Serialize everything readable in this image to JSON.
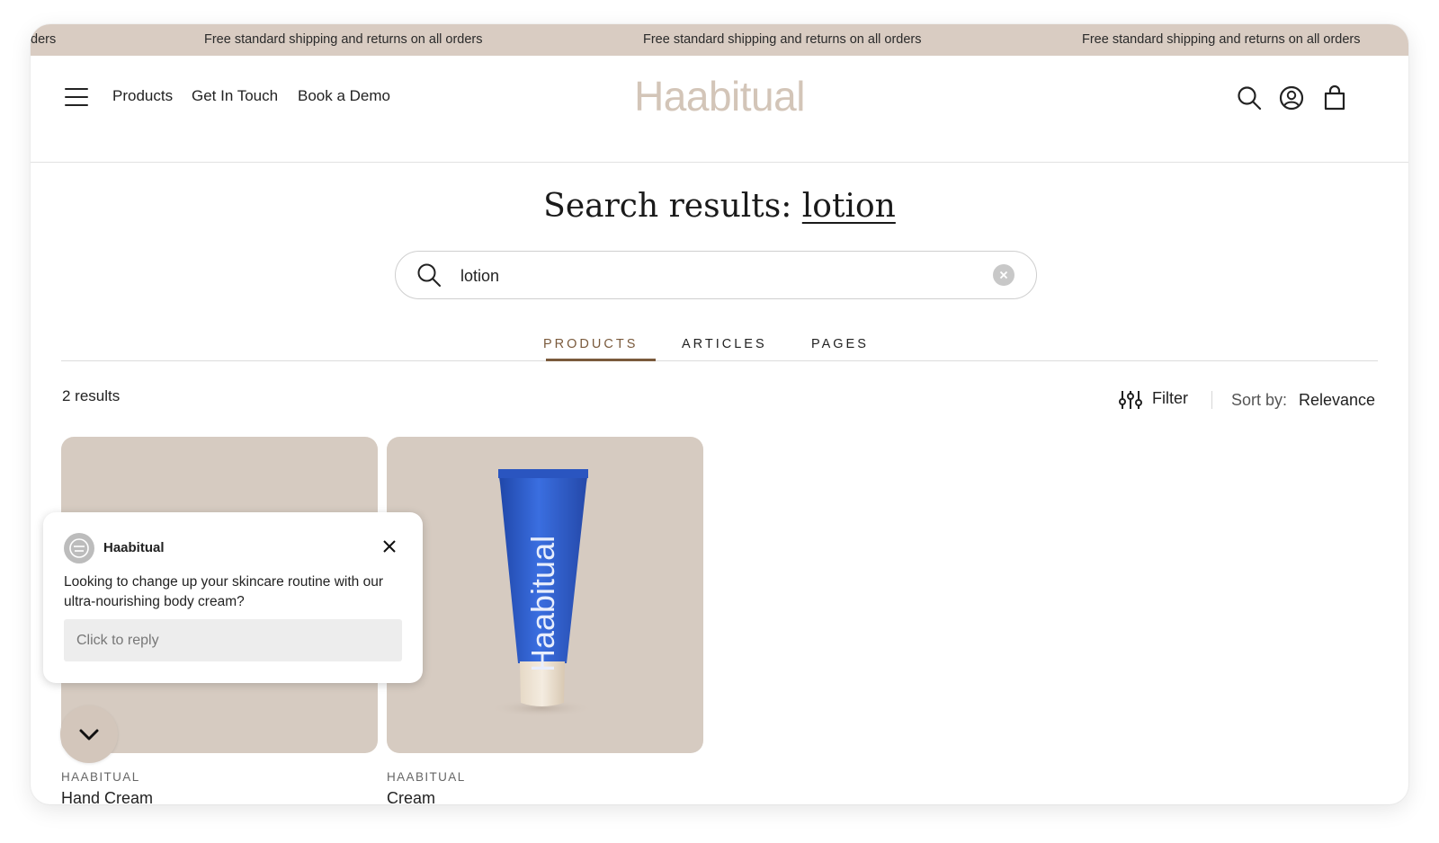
{
  "announcement": {
    "items": [
      "ders",
      "Free standard shipping and returns on all orders",
      "Free standard shipping and returns on all orders",
      "Free standard shipping and returns on all orders"
    ]
  },
  "header": {
    "nav": [
      "Products",
      "Get In Touch",
      "Book a Demo"
    ],
    "logo": "Haabitual",
    "icons": [
      "search-icon",
      "account-icon",
      "cart-icon",
      "menu-icon"
    ]
  },
  "search": {
    "title_prefix": "Search results: ",
    "query": "lotion",
    "input_value": "lotion"
  },
  "tabs": [
    {
      "label": "PRODUCTS",
      "active": true
    },
    {
      "label": "ARTICLES",
      "active": false
    },
    {
      "label": "PAGES",
      "active": false
    }
  ],
  "results": {
    "count": "2 results",
    "filter_label": "Filter",
    "sort_label": "Sort by:",
    "sort_value": "Relevance"
  },
  "products": [
    {
      "vendor": "HAABITUAL",
      "name": "Hand Cream"
    },
    {
      "vendor": "HAABITUAL",
      "name": "Cream",
      "tube_text": "Haabitual"
    }
  ],
  "chat": {
    "brand": "Haabitual",
    "message": "Looking to change up your skincare routine with our ultra-nourishing body cream?",
    "reply_placeholder": "Click to reply"
  },
  "colors": {
    "announcement_bg": "#d9ccc2",
    "logo": "#d3c5b8",
    "accent_tab": "#7a5a3c",
    "product_bg": "#d6cbc1",
    "tube_blue": "#2f5fc9"
  }
}
